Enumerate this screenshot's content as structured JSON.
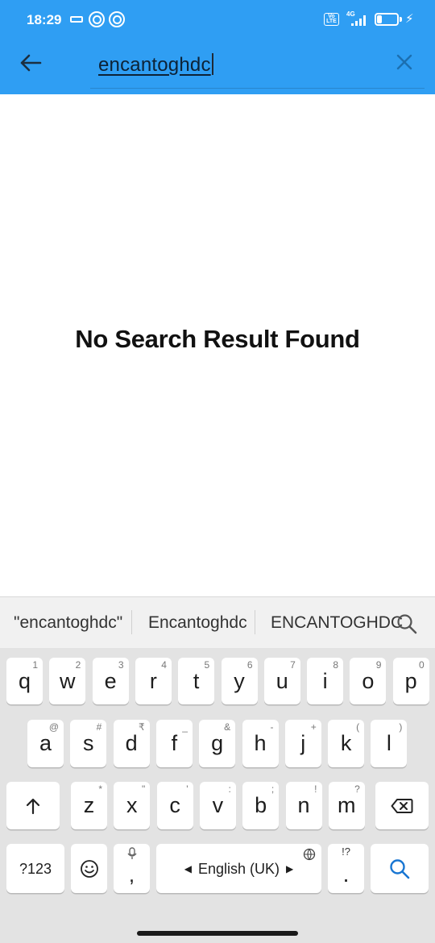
{
  "status_bar": {
    "time": "18:29",
    "volte_label": "Vo LTE",
    "network": "4G",
    "battery_level": "25"
  },
  "search": {
    "query": "encantoghdc",
    "back_icon": "arrow-left-icon",
    "clear_icon": "close-icon"
  },
  "main": {
    "empty_message": "No Search Result Found"
  },
  "keyboard": {
    "suggestions": [
      "\"encantoghdc\"",
      "Encantoghdc",
      "ENCANTOGHDC"
    ],
    "row1": [
      {
        "k": "q",
        "h": "1"
      },
      {
        "k": "w",
        "h": "2"
      },
      {
        "k": "e",
        "h": "3"
      },
      {
        "k": "r",
        "h": "4"
      },
      {
        "k": "t",
        "h": "5"
      },
      {
        "k": "y",
        "h": "6"
      },
      {
        "k": "u",
        "h": "7"
      },
      {
        "k": "i",
        "h": "8"
      },
      {
        "k": "o",
        "h": "9"
      },
      {
        "k": "p",
        "h": "0"
      }
    ],
    "row2": [
      {
        "k": "a",
        "h": "@"
      },
      {
        "k": "s",
        "h": "#"
      },
      {
        "k": "d",
        "h": "₹"
      },
      {
        "k": "f",
        "h": "_"
      },
      {
        "k": "g",
        "h": "&"
      },
      {
        "k": "h",
        "h": "-"
      },
      {
        "k": "j",
        "h": "+"
      },
      {
        "k": "k",
        "h": "("
      },
      {
        "k": "l",
        "h": ")"
      }
    ],
    "row3": [
      {
        "k": "z",
        "h": "*"
      },
      {
        "k": "x",
        "h": "\""
      },
      {
        "k": "c",
        "h": "'"
      },
      {
        "k": "v",
        "h": ":"
      },
      {
        "k": "b",
        "h": ";"
      },
      {
        "k": "n",
        "h": "!"
      },
      {
        "k": "m",
        "h": "?"
      }
    ],
    "symbols_label": "?123",
    "comma_label": ",",
    "space_label": "English (UK)",
    "period_label": ".",
    "period_hint": "!?"
  },
  "colors": {
    "accent": "#2f9ef3",
    "key_bg": "#ffffff",
    "keyboard_bg": "#e3e3e3"
  }
}
